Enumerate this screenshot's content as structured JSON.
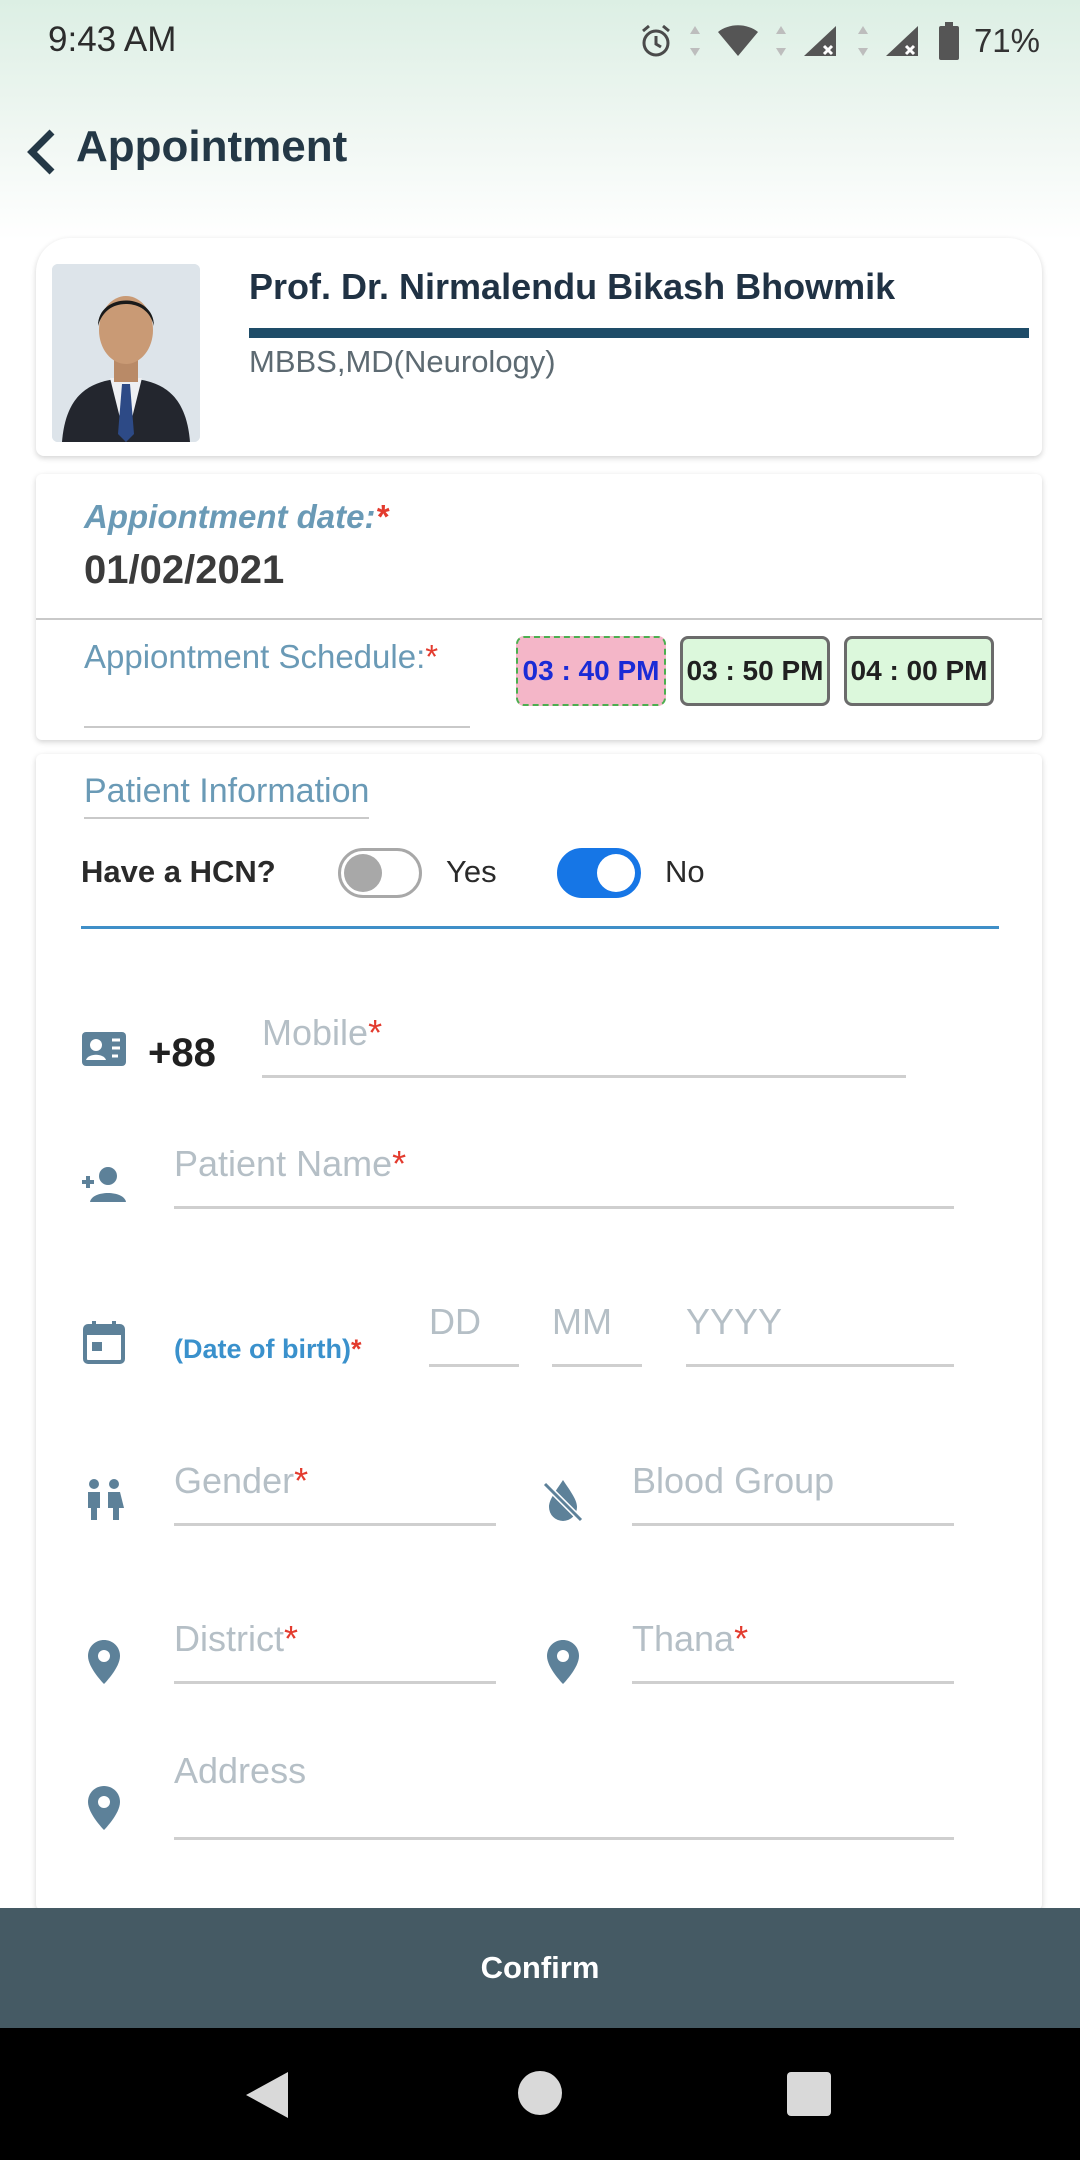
{
  "status_bar": {
    "time": "9:43 AM",
    "battery": "71%"
  },
  "header": {
    "title": "Appointment"
  },
  "doctor": {
    "name": "Prof. Dr. Nirmalendu Bikash Bhowmik",
    "degree": "MBBS,MD(Neurology)"
  },
  "appointment": {
    "date_label": "Appiontment date:",
    "date_value": "01/02/2021",
    "schedule_label": "Appiontment Schedule:",
    "slots": [
      "03 : 40 PM",
      "03 : 50 PM",
      "04 : 00 PM"
    ],
    "selected_slot": "03 : 40 PM"
  },
  "patient": {
    "section_title": "Patient Information",
    "hcn_label": "Have a HCN?",
    "yes_label": "Yes",
    "no_label": "No",
    "hcn_yes_on": false,
    "hcn_no_on": true,
    "country_code": "+88",
    "mobile_placeholder": "Mobile",
    "name_placeholder": "Patient Name",
    "dob_label": "(Date of birth)",
    "dd_placeholder": "DD",
    "mm_placeholder": "MM",
    "yyyy_placeholder": "YYYY",
    "gender_placeholder": "Gender",
    "blood_placeholder": "Blood Group",
    "district_placeholder": "District",
    "thana_placeholder": "Thana",
    "address_placeholder": "Address",
    "required_mark": "*"
  },
  "confirm_label": "Confirm",
  "colors": {
    "accent_blue": "#1676e6",
    "label_blue": "#6a9ab6",
    "confirm_bar": "#455a64",
    "required_red": "#e33b2e",
    "selected_slot_bg": "#f4b6c8",
    "slot_bg": "#dcf8dc"
  }
}
